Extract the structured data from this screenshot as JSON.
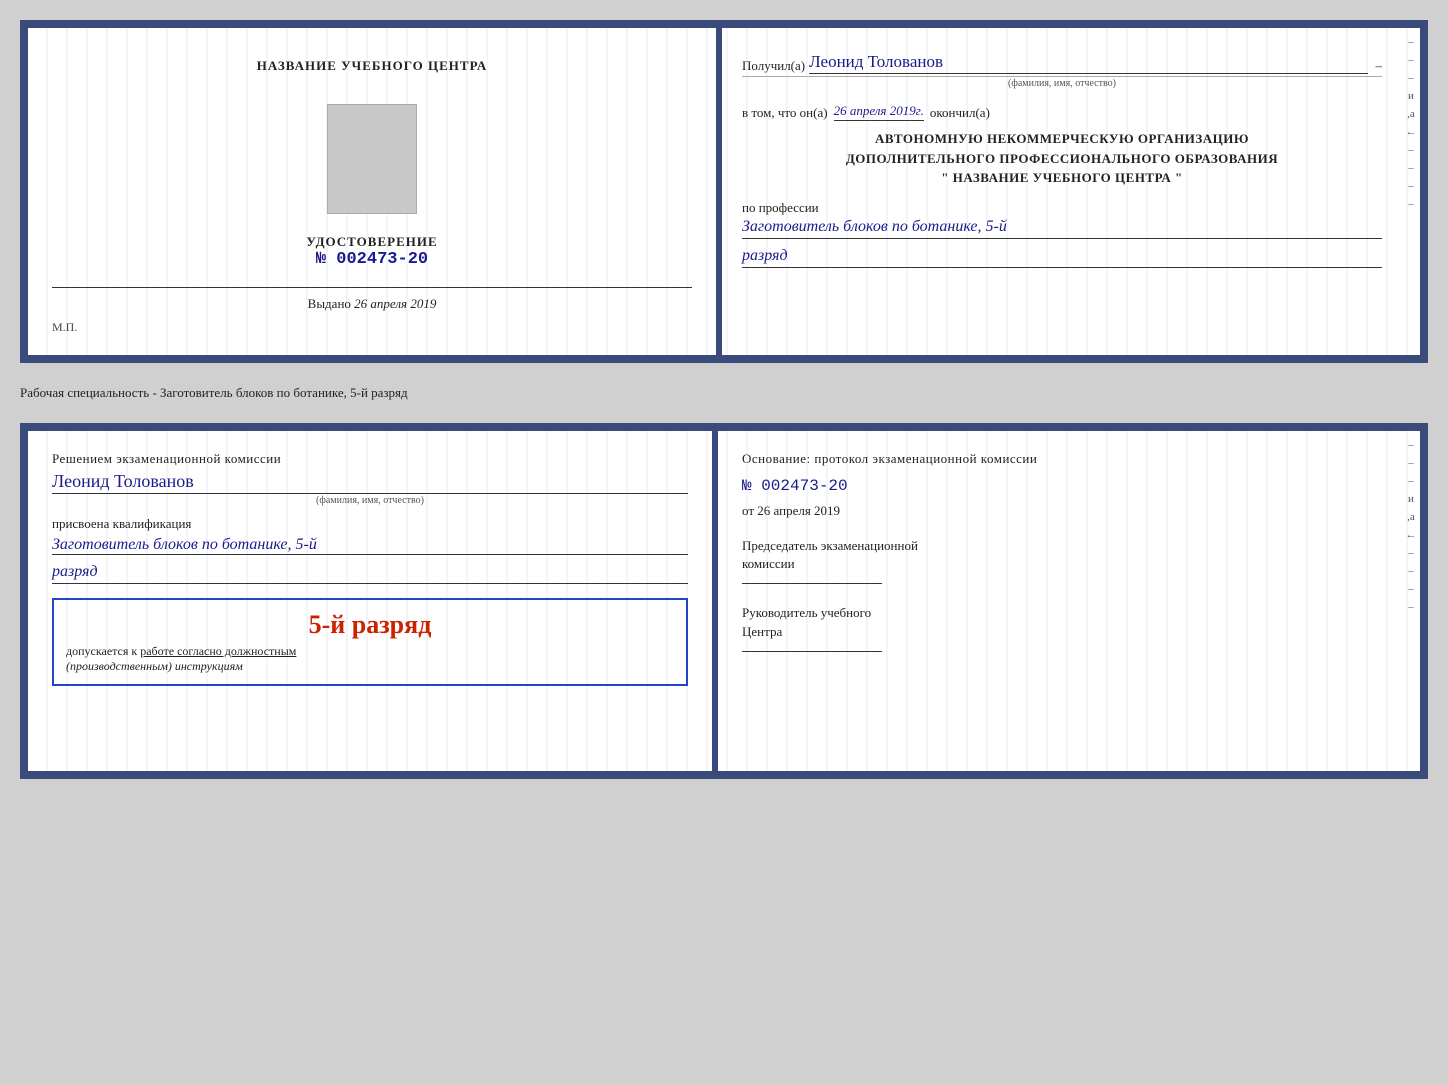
{
  "doc1": {
    "left": {
      "title": "НАЗВАНИЕ УЧЕБНОГО ЦЕНТРА",
      "udostoverenie_label": "УДОСТОВЕРЕНИЕ",
      "number": "№ 002473-20",
      "vydano_label": "Выдано",
      "vydano_date": "26 апреля 2019",
      "mp_label": "М.П."
    },
    "right": {
      "poluchil_prefix": "Получил(а)",
      "recipient_name": "Леонид Толованов",
      "recipient_sub": "(фамилия, имя, отчество)",
      "vtom_prefix": "в том, что он(а)",
      "date_cursive": "26 апреля 2019г.",
      "okonchil": "окончил(а)",
      "org_line1": "АВТОНОМНУЮ НЕКОММЕРЧЕСКУЮ ОРГАНИЗАЦИЮ",
      "org_line2": "ДОПОЛНИТЕЛЬНОГО ПРОФЕССИОНАЛЬНОГО ОБРАЗОВАНИЯ",
      "org_line3": "\"  НАЗВАНИЕ УЧЕБНОГО ЦЕНТРА  \"",
      "po_professii": "по профессии",
      "profession_cursive": "Заготовитель блоков по ботанике, 5-й",
      "razryad_cursive": "разряд"
    }
  },
  "annotation": {
    "text": "Рабочая специальность - Заготовитель блоков по ботанике, 5-й разряд"
  },
  "doc2": {
    "left": {
      "resheniem": "Решением экзаменационной комиссии",
      "person_name": "Леонид Толованов",
      "fio_sub": "(фамилия, имя, отчество)",
      "prisvoena": "присвоена квалификация",
      "qualification": "Заготовитель блоков по ботанике, 5-й",
      "razryad": "разряд",
      "stamp_rank": "5-й разряд",
      "stamp_dopusk1": "допускается к",
      "stamp_dopusk2": "работе согласно должностным",
      "stamp_dopusk3": "(производственным) инструкциям"
    },
    "right": {
      "osnovanie": "Основание: протокол экзаменационной комиссии",
      "proto_number": "№  002473-20",
      "ot_prefix": "от",
      "ot_date": "26 апреля 2019",
      "chairman_label1": "Председатель экзаменационной",
      "chairman_label2": "комиссии",
      "rukavod_label1": "Руководитель учебного",
      "rukavod_label2": "Центра"
    }
  }
}
